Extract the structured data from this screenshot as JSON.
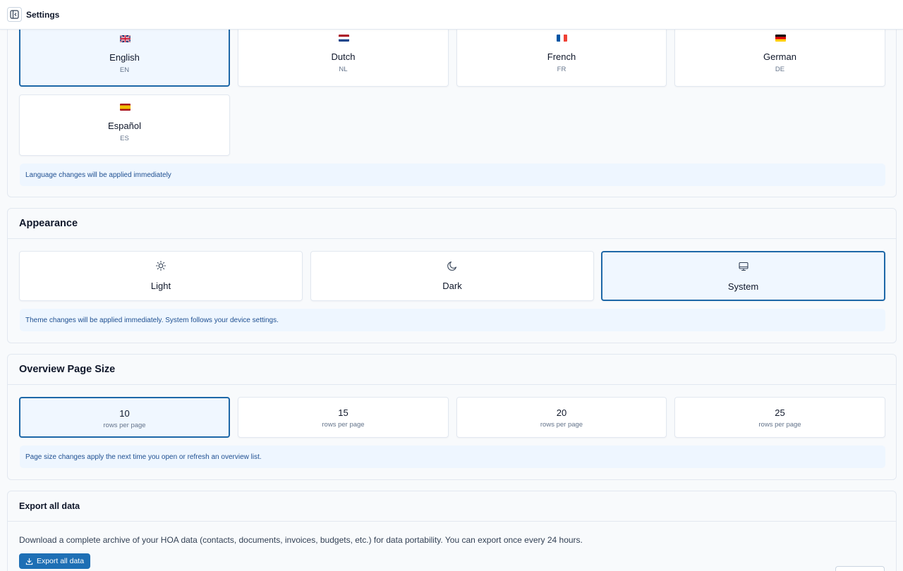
{
  "topbar": {
    "title": "Settings",
    "toggle_icon": "sidebar-toggle-icon"
  },
  "language": {
    "options": [
      {
        "name": "English",
        "code": "EN",
        "flag": "uk-flag-icon",
        "selected": true
      },
      {
        "name": "Dutch",
        "code": "NL",
        "flag": "nl-flag-icon",
        "selected": false
      },
      {
        "name": "French",
        "code": "FR",
        "flag": "fr-flag-icon",
        "selected": false
      },
      {
        "name": "German",
        "code": "DE",
        "flag": "de-flag-icon",
        "selected": false
      },
      {
        "name": "Español",
        "code": "ES",
        "flag": "es-flag-icon",
        "selected": false
      }
    ],
    "note": "Language changes will be applied immediately"
  },
  "appearance": {
    "title": "Appearance",
    "options": [
      {
        "name": "Light",
        "icon": "sun-icon",
        "selected": false
      },
      {
        "name": "Dark",
        "icon": "moon-icon",
        "selected": false
      },
      {
        "name": "System",
        "icon": "monitor-icon",
        "selected": true
      }
    ],
    "note": "Theme changes will be applied immediately. System follows your device settings."
  },
  "page_size": {
    "title": "Overview Page Size",
    "options": [
      {
        "value": "10",
        "label": "rows per page",
        "selected": true
      },
      {
        "value": "15",
        "label": "rows per page",
        "selected": false
      },
      {
        "value": "20",
        "label": "rows per page",
        "selected": false
      },
      {
        "value": "25",
        "label": "rows per page",
        "selected": false
      }
    ],
    "note": "Page size changes apply the next time you open or refresh an overview list."
  },
  "export": {
    "title": "Export all data",
    "description": "Download a complete archive of your HOA data (contacts, documents, invoices, budgets, etc.) for data portability. You can export once every 24 hours.",
    "button_label": "Export all data",
    "button_icon": "download-icon"
  },
  "colors": {
    "accent": "#1e68a8",
    "selected_bg": "#f0f7ff",
    "note_bg": "#eef6ff",
    "note_text": "#1e4f91",
    "button_bg": "#1e6fb5"
  }
}
